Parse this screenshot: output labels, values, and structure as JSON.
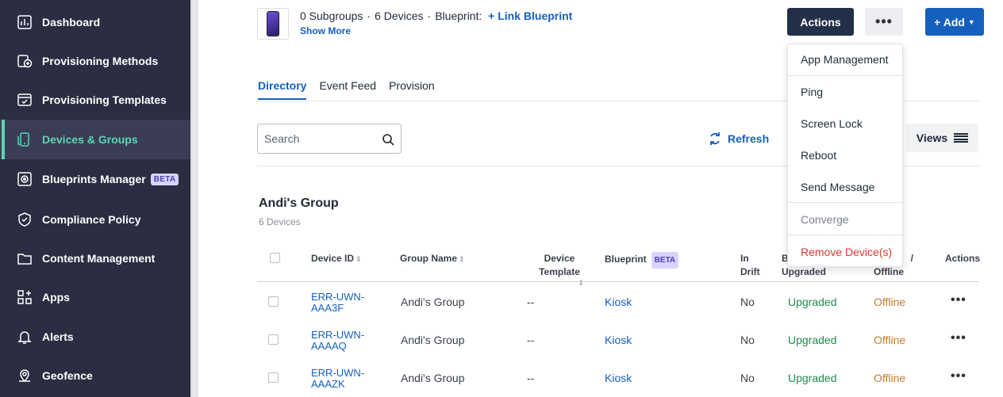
{
  "sidebar": {
    "items": [
      {
        "label": "Dashboard",
        "icon": "dashboard-icon"
      },
      {
        "label": "Provisioning Methods",
        "icon": "provisioning-methods-icon"
      },
      {
        "label": "Provisioning Templates",
        "icon": "provisioning-templates-icon"
      },
      {
        "label": "Devices & Groups",
        "icon": "devices-groups-icon",
        "active": true
      },
      {
        "label": "Blueprints Manager",
        "icon": "blueprints-icon",
        "badge": "BETA"
      },
      {
        "label": "Compliance Policy",
        "icon": "shield-icon"
      },
      {
        "label": "Content Management",
        "icon": "folder-icon"
      },
      {
        "label": "Apps",
        "icon": "apps-icon"
      },
      {
        "label": "Alerts",
        "icon": "bell-icon"
      },
      {
        "label": "Geofence",
        "icon": "geofence-icon"
      }
    ]
  },
  "header": {
    "subgroups": "0 Subgroups",
    "devices": "6 Devices",
    "blueprint_label": "Blueprint:",
    "link_blueprint": "+ Link Blueprint",
    "show_more": "Show More",
    "actions_label": "Actions",
    "more_label": "•••",
    "add_label": "+ Add"
  },
  "tabs": [
    {
      "label": "Directory",
      "active": true
    },
    {
      "label": "Event Feed"
    },
    {
      "label": "Provision"
    }
  ],
  "toolbar": {
    "search_placeholder": "Search",
    "refresh_label": "Refresh",
    "views_label": "Views"
  },
  "group": {
    "title": "Andi's Group",
    "count": "6 Devices"
  },
  "table": {
    "headers": {
      "device_id": "Device ID",
      "group_name": "Group Name",
      "device_template_1": "Device",
      "device_template_2": "Template",
      "blueprint": "Blueprint",
      "blueprint_badge": "BETA",
      "in_drift_1": "In",
      "in_drift_2": "Drift",
      "upgraded_1": "B",
      "upgraded_2": "Upgraded",
      "status_1": "/",
      "status_2": "Offline",
      "actions": "Actions"
    },
    "rows": [
      {
        "id_1": "ERR-UWN-",
        "id_2": "AAA3F",
        "group": "Andi's Group",
        "template": "--",
        "blueprint": "Kiosk",
        "drift": "No",
        "upgraded": "Upgraded",
        "status": "Offline"
      },
      {
        "id_1": "ERR-UWN-",
        "id_2": "AAAAQ",
        "group": "Andi's Group",
        "template": "--",
        "blueprint": "Kiosk",
        "drift": "No",
        "upgraded": "Upgraded",
        "status": "Offline"
      },
      {
        "id_1": "ERR-UWN-",
        "id_2": "AAAZK",
        "group": "Andi's Group",
        "template": "--",
        "blueprint": "Kiosk",
        "drift": "No",
        "upgraded": "Upgraded",
        "status": "Offline"
      }
    ]
  },
  "menu": {
    "items": [
      {
        "label": "App Management"
      },
      {
        "label": "Ping"
      },
      {
        "label": "Screen Lock"
      },
      {
        "label": "Reboot"
      },
      {
        "label": "Send Message"
      },
      {
        "label": "Converge",
        "disabled": true
      },
      {
        "label": "Remove Device(s)",
        "danger": true
      }
    ]
  },
  "colors": {
    "sidebar_bg": "#2b2d42",
    "active_accent": "#5cd6b5",
    "primary": "#1560bd",
    "actions_bg": "#23304a",
    "upgraded": "#1f8a4c",
    "offline": "#c27c2e",
    "danger": "#d63a2f"
  }
}
